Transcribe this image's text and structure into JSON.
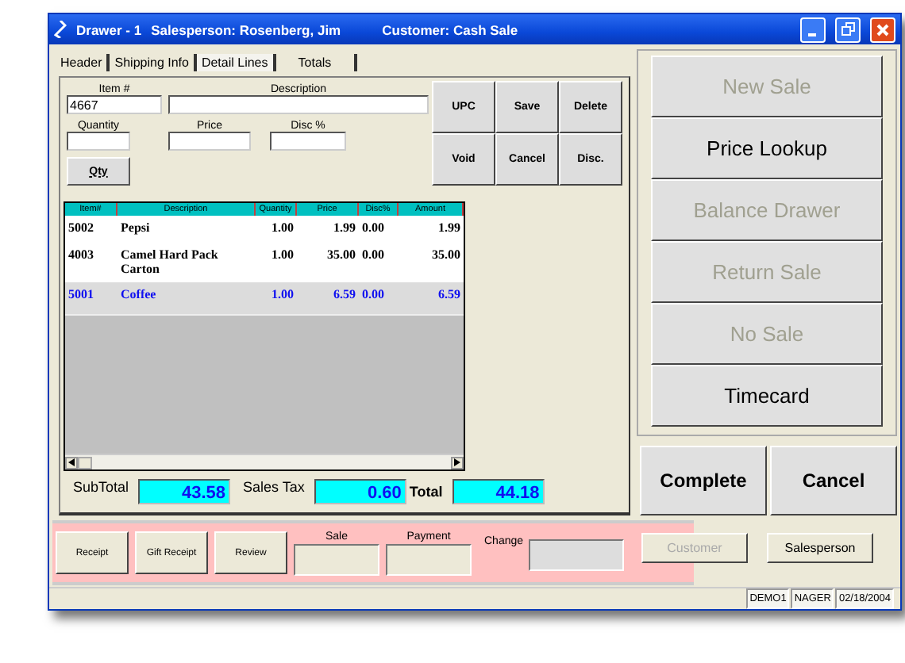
{
  "window": {
    "title_parts": [
      "Drawer - 1",
      "Salesperson: Rosenberg, Jim",
      "Customer: Cash Sale"
    ]
  },
  "tabs": [
    {
      "label": "Header",
      "selected": false
    },
    {
      "label": "Shipping Info",
      "selected": false
    },
    {
      "label": "Detail Lines",
      "selected": true
    },
    {
      "label": "Totals",
      "selected": false
    }
  ],
  "entry": {
    "fields": [
      {
        "label": "Item #",
        "value": "4667"
      },
      {
        "label": "Description"
      },
      {
        "label": "Quantity"
      },
      {
        "label": "Price"
      },
      {
        "label": "Disc %"
      }
    ],
    "qty_button": "Qty"
  },
  "line_buttons": [
    "UPC",
    "Save",
    "Delete",
    "Void",
    "Cancel",
    "Disc."
  ],
  "table": {
    "columns": [
      "Item#",
      "Description",
      "Quantity",
      "Price",
      "Disc%",
      "Amount"
    ],
    "rows": [
      {
        "cells": [
          "5002",
          "Pepsi",
          "1.00",
          "1.99",
          "0.00",
          "1.99"
        ],
        "selected": false
      },
      {
        "cells": [
          "4003",
          "Camel Hard Pack Carton",
          "1.00",
          "35.00",
          "0.00",
          "35.00"
        ],
        "selected": false
      },
      {
        "cells": [
          "5001",
          "Coffee",
          "1.00",
          "6.59",
          "0.00",
          "6.59"
        ],
        "selected": true
      }
    ]
  },
  "totals": [
    {
      "label": "SubTotal",
      "value": "43.58",
      "bold": false
    },
    {
      "label": "Sales Tax",
      "value": "0.60",
      "bold": false
    },
    {
      "label": "Total",
      "value": "44.18",
      "bold": true
    }
  ],
  "last_sale": {
    "buttons": [
      "Receipt",
      "Gift Receipt",
      "Review"
    ],
    "fields": [
      {
        "label": "Sale"
      },
      {
        "label": "Payment"
      },
      {
        "label": "Change"
      }
    ]
  },
  "actions": [
    {
      "label": "New Sale",
      "disabled": true
    },
    {
      "label": "Price Lookup",
      "disabled": false
    },
    {
      "label": "Balance Drawer",
      "disabled": true
    },
    {
      "label": "Return Sale",
      "disabled": true
    },
    {
      "label": "No Sale",
      "disabled": true
    },
    {
      "label": "Timecard",
      "disabled": false
    }
  ],
  "finish_buttons": [
    "Complete",
    "Cancel"
  ],
  "lookup_buttons": [
    {
      "label": "Customer",
      "disabled": true
    },
    {
      "label": "Salesperson",
      "disabled": false
    }
  ],
  "status_bar": [
    "DEMO1",
    "NAGER",
    "02/18/2004"
  ]
}
